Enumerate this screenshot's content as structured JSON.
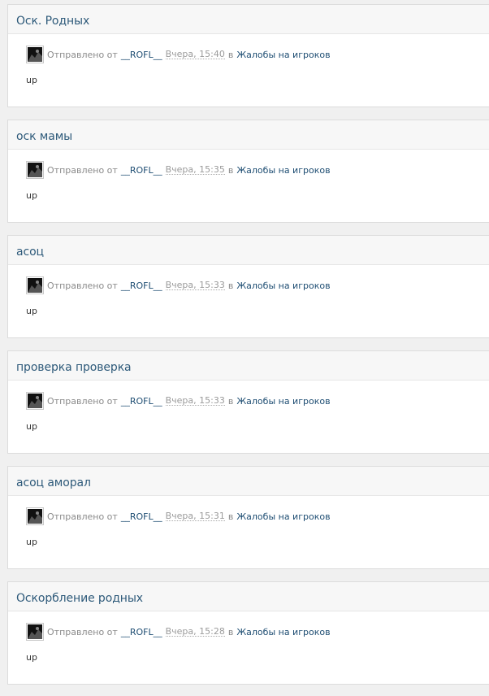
{
  "posts": [
    {
      "title": "Оск. Родных",
      "sent_label": "Отправлено от",
      "author": "__ROFL__",
      "time": "Вчера, 15:40",
      "in_label": "в",
      "forum": "Жалобы на игроков",
      "body": "up"
    },
    {
      "title": "оск мамы",
      "sent_label": "Отправлено от",
      "author": "__ROFL__",
      "time": "Вчера, 15:35",
      "in_label": "в",
      "forum": "Жалобы на игроков",
      "body": "up"
    },
    {
      "title": "асоц",
      "sent_label": "Отправлено от",
      "author": "__ROFL__",
      "time": "Вчера, 15:33",
      "in_label": "в",
      "forum": "Жалобы на игроков",
      "body": "up"
    },
    {
      "title": "проверка проверка",
      "sent_label": "Отправлено от",
      "author": "__ROFL__",
      "time": "Вчера, 15:33",
      "in_label": "в",
      "forum": "Жалобы на игроков",
      "body": "up"
    },
    {
      "title": "асоц аморал",
      "sent_label": "Отправлено от",
      "author": "__ROFL__",
      "time": "Вчера, 15:31",
      "in_label": "в",
      "forum": "Жалобы на игроков",
      "body": "up"
    },
    {
      "title": "Оскорбление родных",
      "sent_label": "Отправлено от",
      "author": "__ROFL__",
      "time": "Вчера, 15:28",
      "in_label": "в",
      "forum": "Жалобы на игроков",
      "body": "up"
    }
  ]
}
